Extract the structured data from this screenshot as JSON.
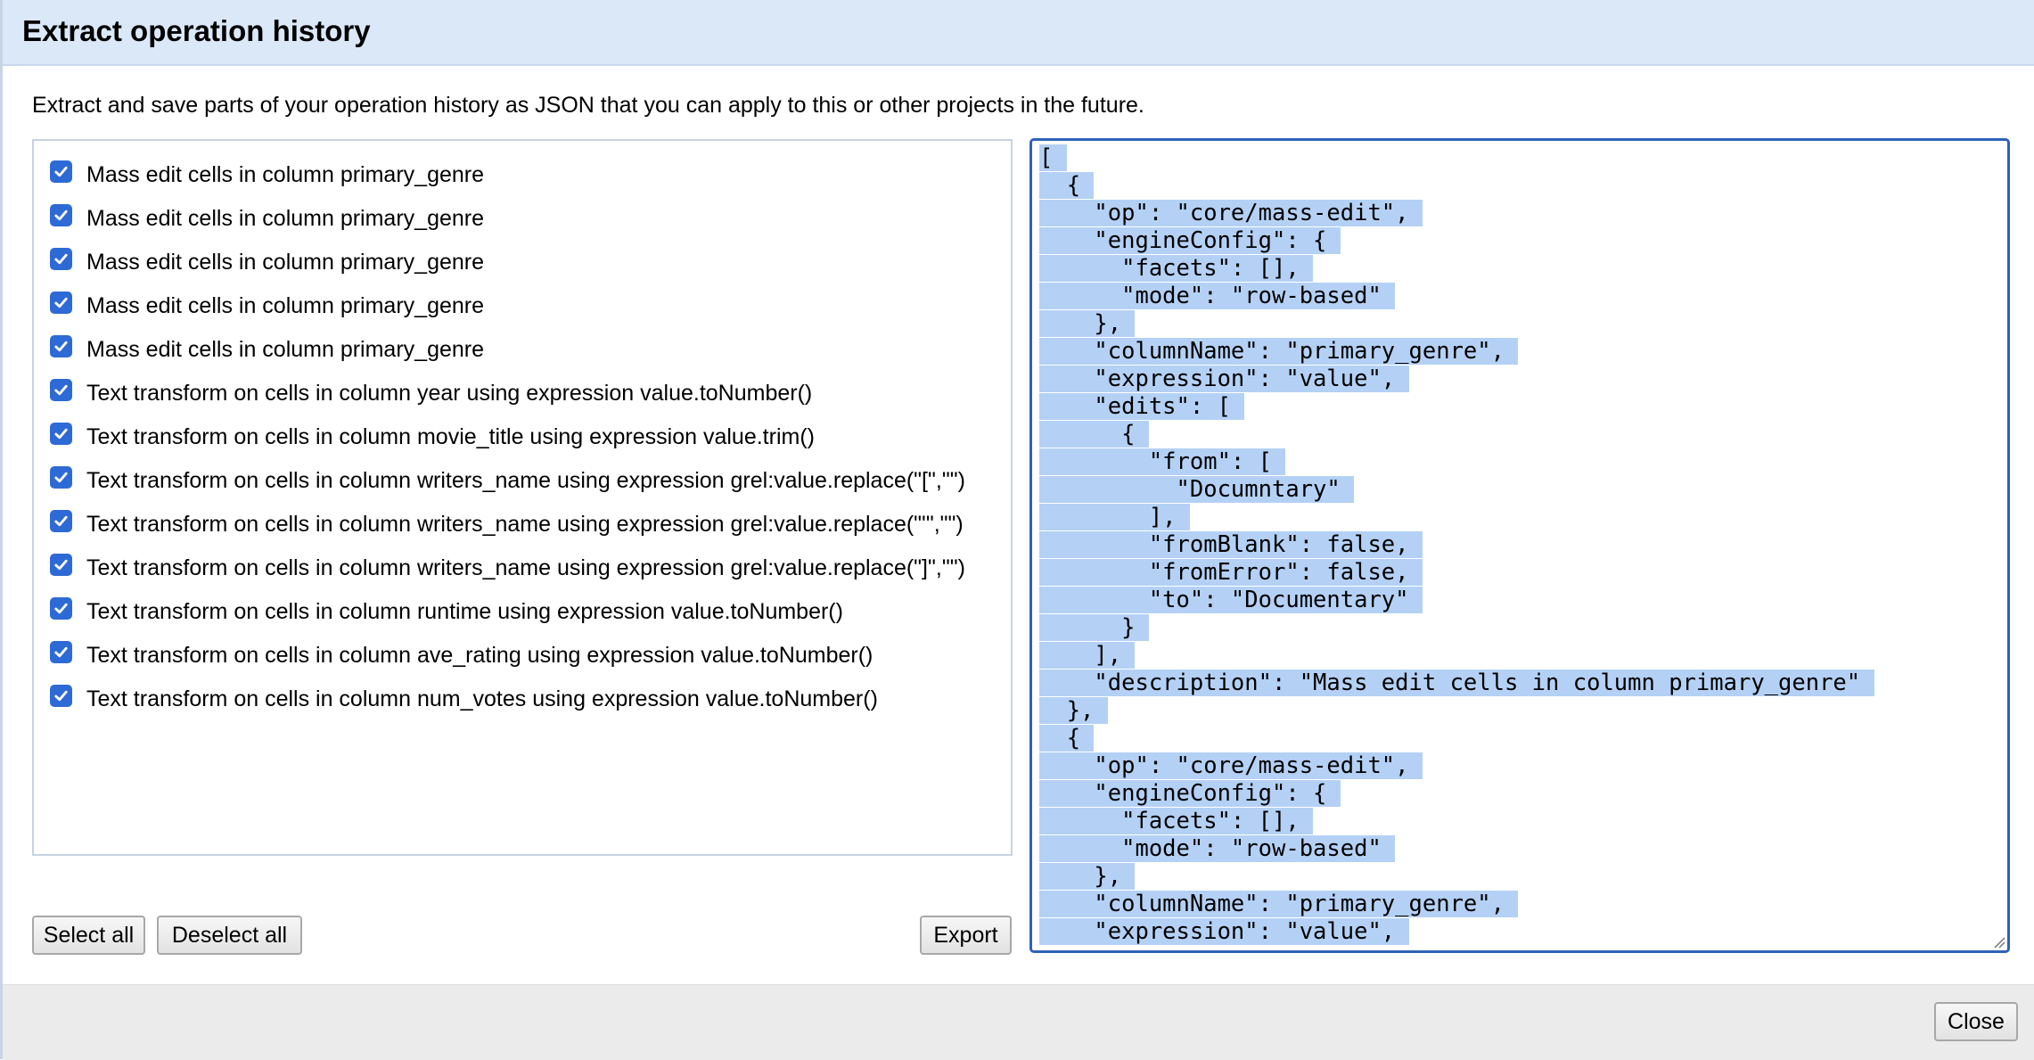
{
  "dialog": {
    "title": "Extract operation history",
    "intro": "Extract and save parts of your operation history as JSON that you can apply to this or other projects in the future."
  },
  "operations": [
    "Mass edit cells in column primary_genre",
    "Mass edit cells in column primary_genre",
    "Mass edit cells in column primary_genre",
    "Mass edit cells in column primary_genre",
    "Mass edit cells in column primary_genre",
    "Text transform on cells in column year using expression value.toNumber()",
    "Text transform on cells in column movie_title using expression value.trim()",
    "Text transform on cells in column writers_name using expression grel:value.replace(\"[\",\"\")",
    "Text transform on cells in column writers_name using expression grel:value.replace(\"'\",\"\")",
    "Text transform on cells in column writers_name using expression grel:value.replace(\"]\",\"\")",
    "Text transform on cells in column runtime using expression value.toNumber()",
    "Text transform on cells in column ave_rating using expression value.toNumber()",
    "Text transform on cells in column num_votes using expression value.toNumber()"
  ],
  "operations_checked": [
    true,
    true,
    true,
    true,
    true,
    true,
    true,
    true,
    true,
    true,
    true,
    true,
    true
  ],
  "buttons": {
    "select_all": "Select all",
    "deselect_all": "Deselect all",
    "export": "Export",
    "close": "Close"
  },
  "json_lines": [
    "[",
    "  {",
    "    \"op\": \"core/mass-edit\",",
    "    \"engineConfig\": {",
    "      \"facets\": [],",
    "      \"mode\": \"row-based\"",
    "    },",
    "    \"columnName\": \"primary_genre\",",
    "    \"expression\": \"value\",",
    "    \"edits\": [",
    "      {",
    "        \"from\": [",
    "          \"Documntary\"",
    "        ],",
    "        \"fromBlank\": false,",
    "        \"fromError\": false,",
    "        \"to\": \"Documentary\"",
    "      }",
    "    ],",
    "    \"description\": \"Mass edit cells in column primary_genre\"",
    "  },",
    "  {",
    "    \"op\": \"core/mass-edit\",",
    "    \"engineConfig\": {",
    "      \"facets\": [],",
    "      \"mode\": \"row-based\"",
    "    },",
    "    \"columnName\": \"primary_genre\",",
    "    \"expression\": \"value\","
  ],
  "colors": {
    "header_bg": "#dae8f8",
    "checkbox": "#2e6ad6",
    "selection": "#b4d1f5",
    "textarea_focus_border": "#2f61b8",
    "footer_bg": "#ebebeb"
  },
  "icons": {
    "checkbox": "checkmark-icon",
    "resize": "resize-grip-icon"
  }
}
